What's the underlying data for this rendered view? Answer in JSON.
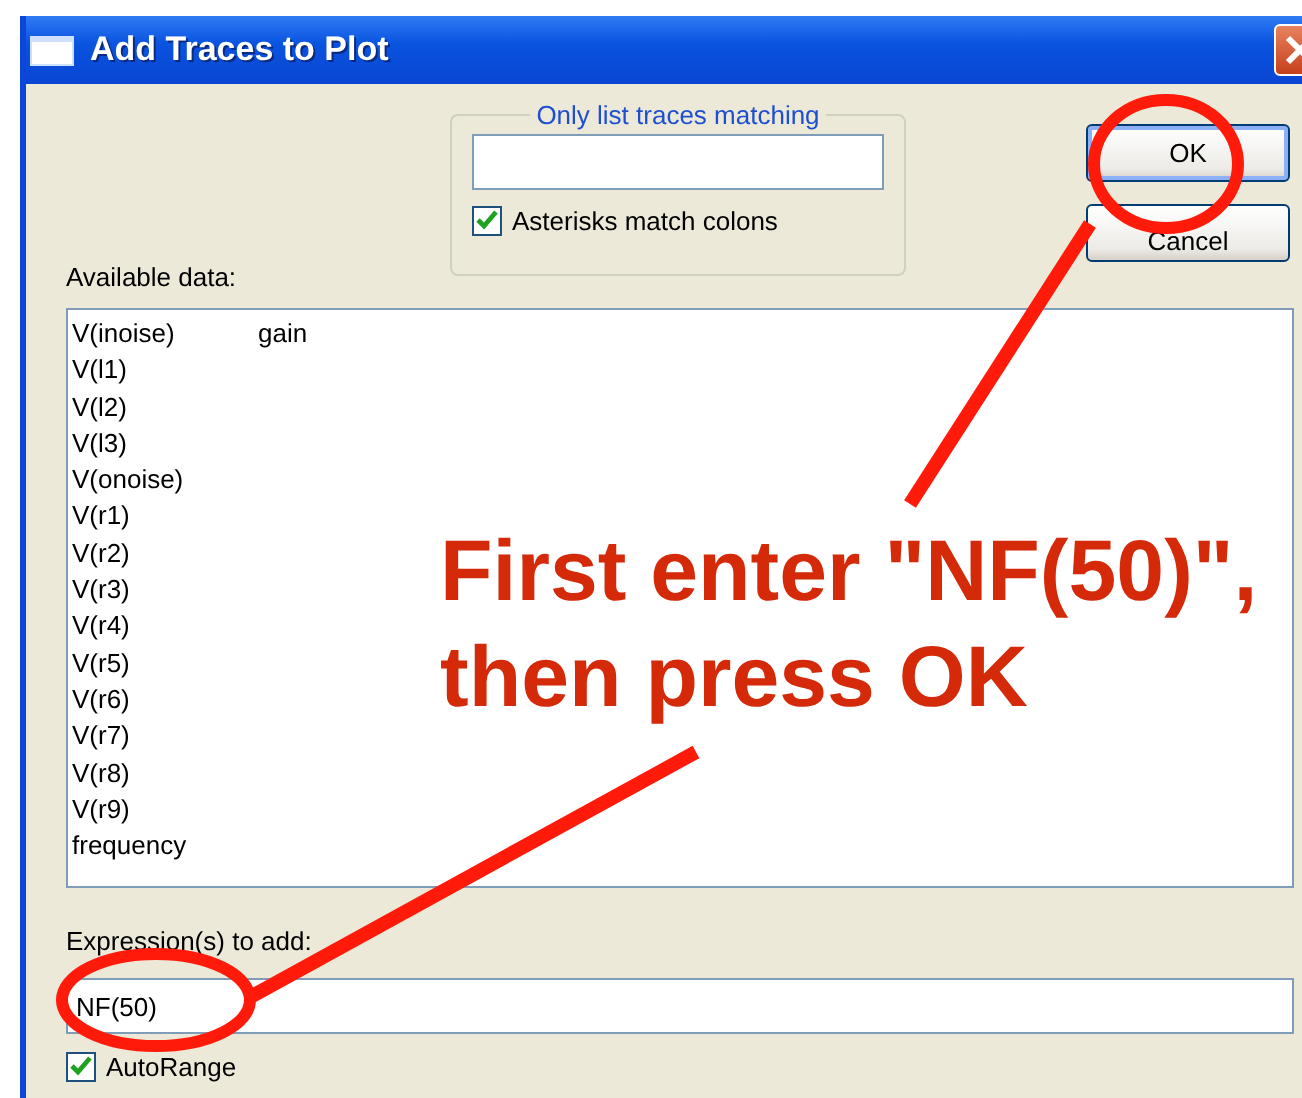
{
  "window": {
    "title": "Add Traces to Plot"
  },
  "filter": {
    "legend": "Only list traces matching",
    "asterisks": {
      "label": "Asterisks match colons",
      "checked": true
    }
  },
  "buttons": [
    {
      "label": "OK",
      "kind": "default"
    },
    {
      "label": "Cancel",
      "kind": "normal"
    }
  ],
  "available_data": {
    "label": "Available data:",
    "items": [
      "V(inoise)",
      "V(l1)",
      "V(l2)",
      "V(l3)",
      "V(onoise)",
      "V(r1)",
      "V(r2)",
      "V(r3)",
      "V(r4)",
      "V(r5)",
      "V(r6)",
      "V(r7)",
      "V(r8)",
      "V(r9)",
      "frequency",
      "gain"
    ]
  },
  "expression": {
    "label": "Expression(s) to add:",
    "value": "NF(50)"
  },
  "autorange": {
    "label": "AutoRange",
    "checked": true
  },
  "annotation": {
    "lines": [
      "First enter \"NF(50)\",",
      "then press OK"
    ]
  }
}
